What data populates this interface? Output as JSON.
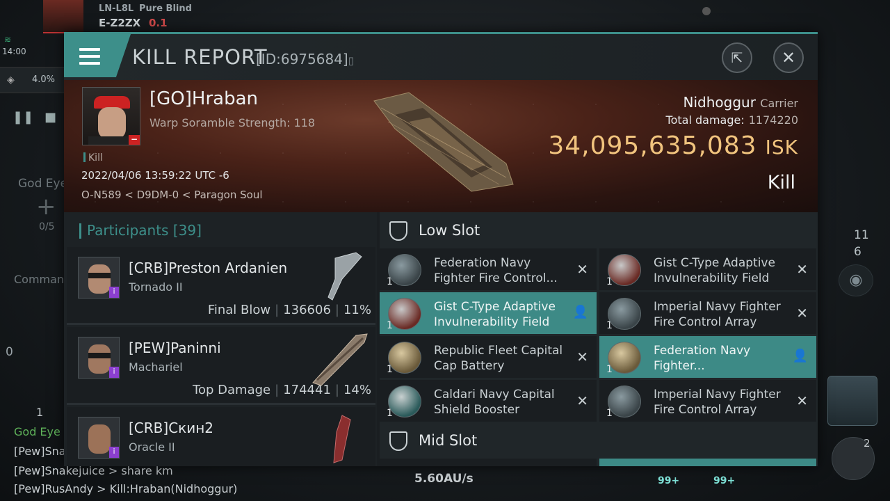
{
  "hud": {
    "system_prev": "LN-L8L",
    "pure_blind": "Pure Blind",
    "system_current": "E-Z2ZX",
    "security": "0.1",
    "time": "14:00",
    "cargo_percent": "4.0%",
    "god_eye": "God Eye",
    "fleet_count": "0/5",
    "command": "Comman",
    "zero": "0",
    "right_count_1": "11",
    "right_count_2": "6",
    "speed": "5.60AU/s",
    "badge_99a": "99+",
    "badge_99b": "99+",
    "module_badge": "2",
    "chat": [
      {
        "text": "1"
      },
      {
        "text": "God Eye"
      },
      {
        "text": "[Pew]Sna"
      },
      {
        "text": "[Pew]Snakejuice > share km"
      },
      {
        "text": "[Pew]RusAndy > Kill:Hraban(Nidhoggur)"
      }
    ]
  },
  "window": {
    "title": "KILL REPORT",
    "id": "[ID:6975684]",
    "copy_glyph": "▯"
  },
  "victim": {
    "name": "[GO]Hraban",
    "warp": "Warp Soramble Strength: 118",
    "tag": "Kill",
    "datetime": "2022/04/06 13:59:22 UTC -6",
    "location": "O-N589 < D9DM-0 < Paragon Soul",
    "ship": "Nidhoggur",
    "ship_class": "Carrier",
    "damage_label": "Total damage:",
    "damage_value": "1174220",
    "isk_value": "34,095,635,083",
    "isk_unit": "ISK",
    "result": "Kill"
  },
  "participants": {
    "label": "Participants",
    "count": "[39]",
    "rows": [
      {
        "name": "[CRB]Preston Ardanien",
        "ship": "Tornado II",
        "stat_label": "Final Blow",
        "damage": "136606",
        "percent": "11%"
      },
      {
        "name": "[PEW]Paninni",
        "ship": "Machariel",
        "stat_label": "Top Damage",
        "damage": "174441",
        "percent": "14%"
      },
      {
        "name": "[CRB]Скин2",
        "ship": "Oracle II"
      }
    ]
  },
  "fitting": {
    "low_slot": "Low Slot",
    "mid_slot": "Mid Slot",
    "modules": [
      {
        "name": "Federation Navy Fighter Fire Control...",
        "qty": "1",
        "status": "✕"
      },
      {
        "name": "Gist C-Type Adaptive Invulnerability Field",
        "qty": "1",
        "status": "✕"
      },
      {
        "name": "Gist C-Type Adaptive Invulnerability Field",
        "qty": "1",
        "status": "👤"
      },
      {
        "name": "Imperial Navy Fighter Fire Control Array",
        "qty": "1",
        "status": "✕"
      },
      {
        "name": "Republic Fleet Capital Cap Battery",
        "qty": "1",
        "status": "✕"
      },
      {
        "name": "Federation Navy Fighter...",
        "qty": "1",
        "status": "👤"
      },
      {
        "name": "Caldari Navy Capital Shield Booster",
        "qty": "1",
        "status": "✕"
      },
      {
        "name": "Imperial Navy Fighter Fire Control Array",
        "qty": "1",
        "status": "✕"
      }
    ]
  }
}
